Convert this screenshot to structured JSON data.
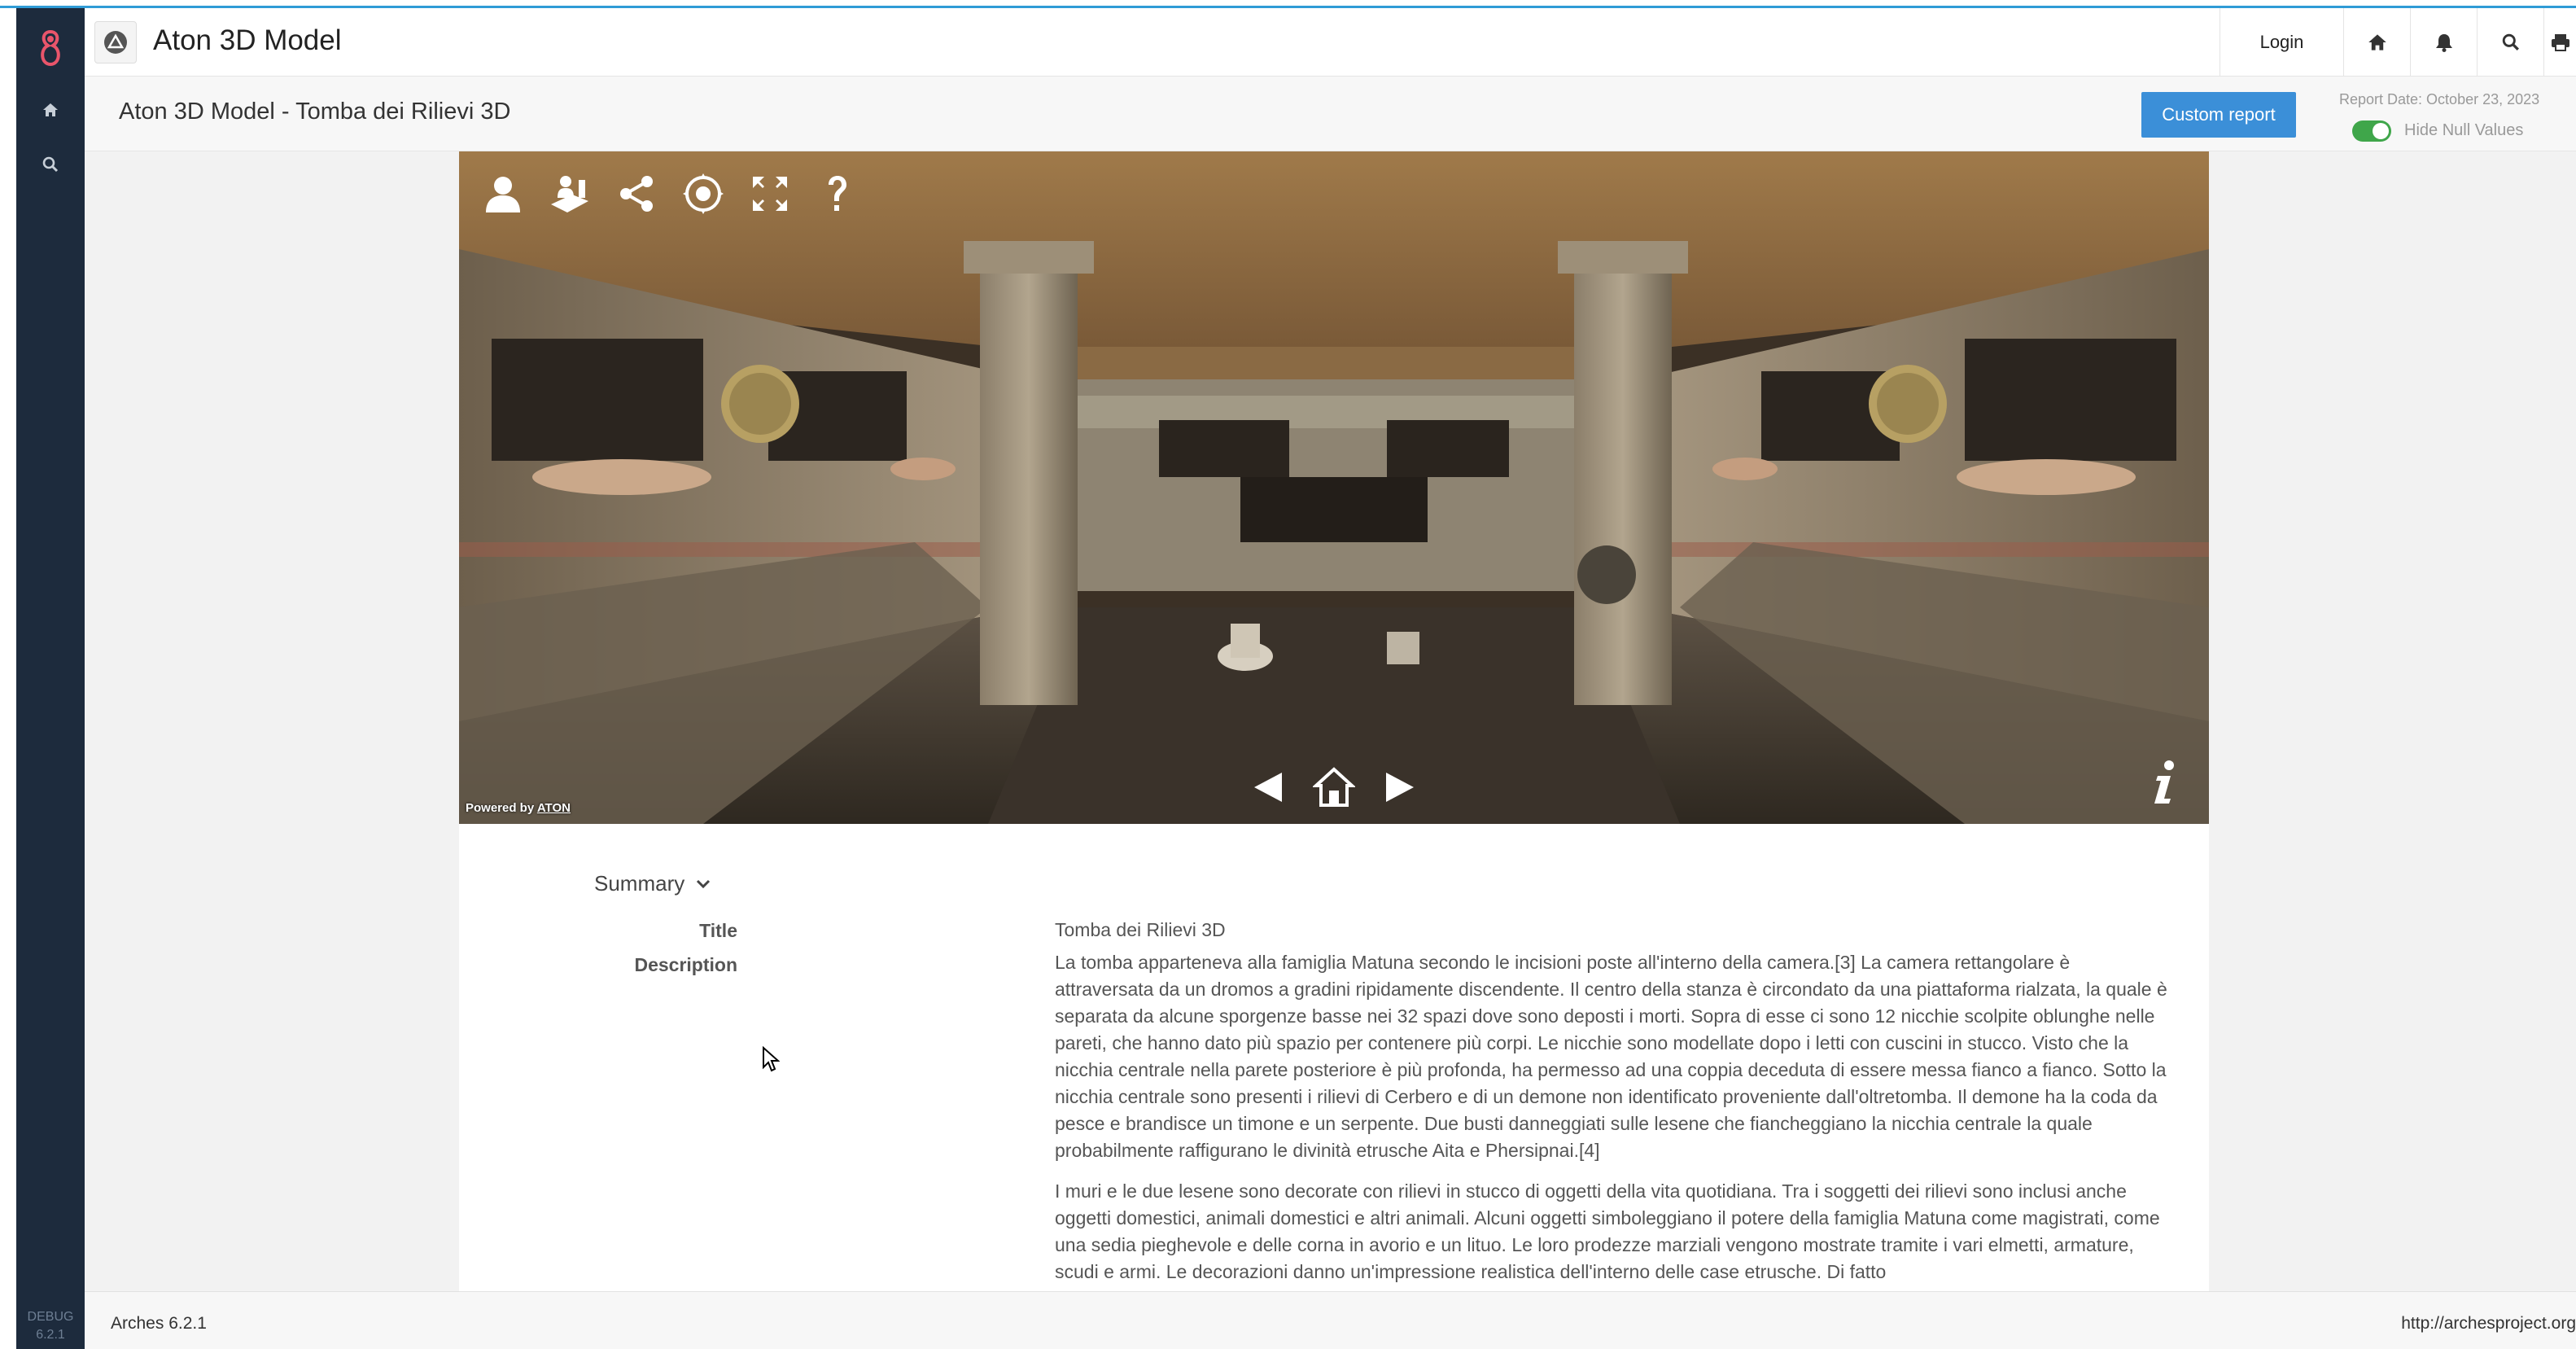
{
  "app": {
    "title": "Aton 3D Model"
  },
  "header": {
    "login_label": "Login",
    "icons": [
      "home-icon",
      "bell-icon",
      "search-icon",
      "print-icon"
    ]
  },
  "sidebar": {
    "items": [
      "home-icon",
      "search-icon"
    ],
    "debug_label": "DEBUG",
    "debug_version": "6.2.1"
  },
  "subheader": {
    "page_title": "Aton 3D Model - Tomba dei Rilievi 3D",
    "custom_report_label": "Custom report",
    "report_date": "Report Date: October 23, 2023",
    "hide_null_label": "Hide Null Values",
    "hide_null_enabled": true
  },
  "viewer": {
    "toolbar_icons": [
      "user-icon",
      "scene-layers-icon",
      "share-icon",
      "navigation-mode-icon",
      "fullscreen-icon",
      "help-icon"
    ],
    "powered_by": "Powered by",
    "powered_link": "ATON",
    "nav_icons": [
      "previous-arrow-icon",
      "home-view-icon",
      "next-arrow-icon"
    ],
    "info_icon": "info-icon"
  },
  "summary": {
    "section_label": "Summary",
    "fields": {
      "title_label": "Title",
      "title_value": "Tomba dei Rilievi 3D",
      "description_label": "Description",
      "description_p1": "La tomba apparteneva alla famiglia Matuna secondo le incisioni poste all'interno della camera.[3] La camera rettangolare è attraversata da un dromos a gradini ripidamente discendente. Il centro della stanza è circondato da una piattaforma rialzata, la quale è separata da alcune sporgenze basse nei 32 spazi dove sono deposti i morti. Sopra di esse ci sono 12 nicchie scolpite oblunghe nelle pareti, che hanno dato più spazio per contenere più corpi. Le nicchie sono modellate dopo i letti con cuscini in stucco. Visto che la nicchia centrale nella parete posteriore è più profonda, ha permesso ad una coppia deceduta di essere messa fianco a fianco. Sotto la nicchia centrale sono presenti i rilievi di Cerbero e di un demone non identificato proveniente dall'oltretomba. Il demone ha la coda da pesce e brandisce un timone e un serpente. Due busti danneggiati sulle lesene che fiancheggiano la nicchia centrale la quale probabilmente raffigurano le divinità etrusche Aita e Phersipnai.[4]",
      "description_p2": "I muri e le due lesene sono decorate con rilievi in stucco di oggetti della vita quotidiana. Tra i soggetti dei rilievi sono inclusi anche oggetti domestici, animali domestici e altri animali. Alcuni oggetti simboleggiano il potere della famiglia Matuna come magistrati, come una sedia pieghevole e delle corna in avorio e un lituo. Le loro prodezze marziali vengono mostrate tramite i vari elmetti, armature, scudi e armi. Le decorazioni danno un'impressione realistica dell'interno delle case etrusche. Di fatto"
    }
  },
  "footer": {
    "version": "Arches 6.2.1",
    "url": "http://archesproject.org"
  },
  "colors": {
    "accent": "#3b8fd8",
    "sidebar": "#1d2b3d",
    "toggle_on": "#3fa64a",
    "top_border": "#2f9bd6"
  }
}
